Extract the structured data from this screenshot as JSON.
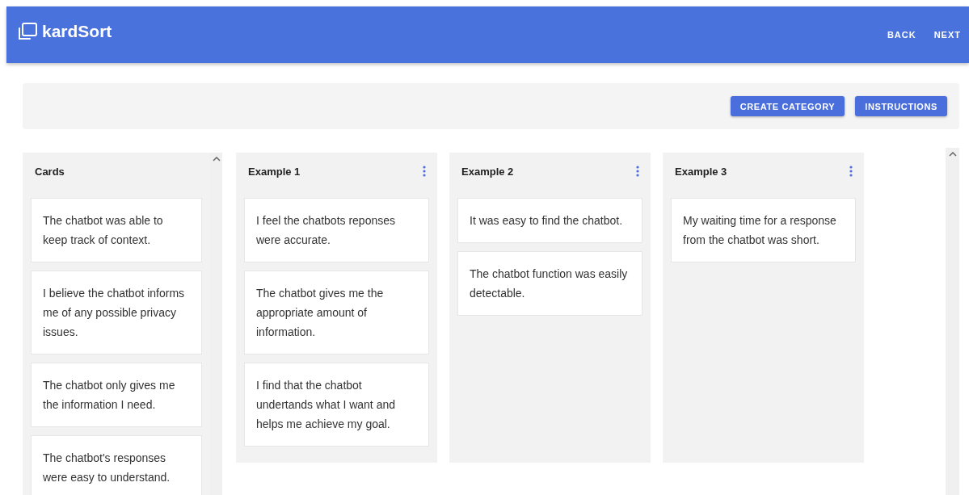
{
  "app": {
    "logo": "kardSort"
  },
  "nav": [
    "BACK",
    "NEXT"
  ],
  "toolbar": {
    "buttons": [
      "CREATE CATEGORY",
      "INSTRUCTIONS"
    ]
  },
  "cards_column": {
    "title": "Cards",
    "cards": [
      "The chatbot was able to keep track of context.",
      "I believe the chatbot informs me of any possible privacy issues.",
      "The chatbot only gives me the information I need.",
      "The chatbot's responses were easy to understand."
    ]
  },
  "categories": [
    {
      "title": "Example 1",
      "cards": [
        "I feel the chatbots reponses were accurate.",
        "The chatbot gives me the appropriate amount of information.",
        "I find that the chatbot undertands what I want and helps me achieve my goal."
      ]
    },
    {
      "title": "Example 2",
      "cards": [
        "It was easy to find the chatbot.",
        "The chatbot function was easily detectable."
      ]
    },
    {
      "title": "Example 3",
      "cards": [
        "My waiting time for a response from the chatbot was short."
      ]
    }
  ]
}
